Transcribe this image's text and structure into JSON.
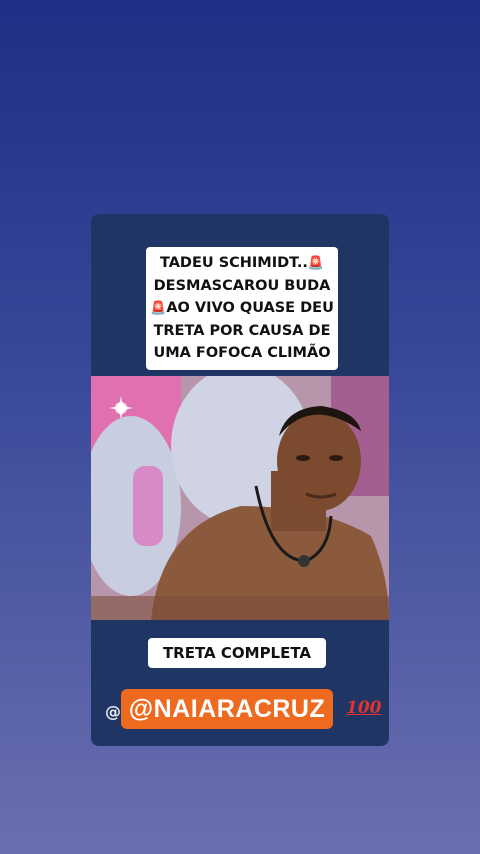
{
  "story": {
    "headline_lines": [
      "TADEU SCHIMIDT..",
      "DESMASCAROU BUDA",
      "AO VIVO QUASE DEU",
      "TRETA POR CAUSA DE",
      "UMA FOFOCA CLIMÃO"
    ],
    "siren_glyph": "🚨",
    "button_label": "TRETA COMPLETA",
    "at_symbol": "@",
    "handle": "@NAIARACRUZ",
    "hundred_emoji_text": "100"
  },
  "colors": {
    "background_top": "#1e2f85",
    "background_bottom": "#6a6fb0",
    "card": "#1f3563",
    "handle_bg": "#ee6a1f",
    "siren": "#d9272e"
  }
}
